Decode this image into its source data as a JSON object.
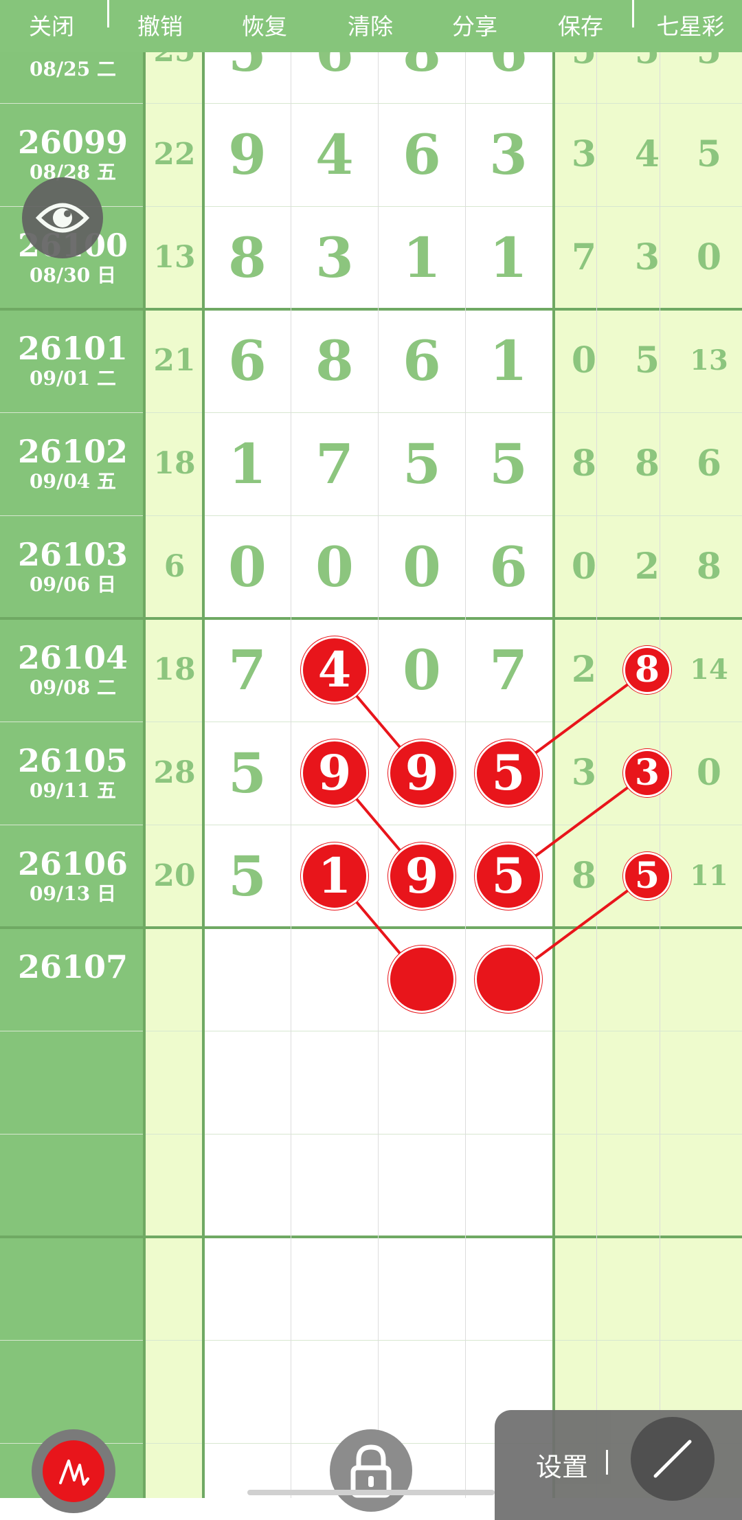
{
  "toolbar": {
    "close": "关闭",
    "undo": "撤销",
    "redo": "恢复",
    "clear": "清除",
    "share": "分享",
    "save": "保存",
    "lottery": "七星彩"
  },
  "rows": [
    {
      "issue": "",
      "date": "08/25 二",
      "sum": "25",
      "main": [
        "5",
        "6",
        "8",
        "6"
      ],
      "tail": [
        "5",
        "5",
        "5"
      ]
    },
    {
      "issue": "26099",
      "date": "08/28 五",
      "sum": "22",
      "main": [
        "9",
        "4",
        "6",
        "3"
      ],
      "tail": [
        "3",
        "4",
        "5"
      ]
    },
    {
      "issue": "26100",
      "date": "08/30 日",
      "sum": "13",
      "main": [
        "8",
        "3",
        "1",
        "1"
      ],
      "tail": [
        "7",
        "3",
        "0"
      ]
    },
    {
      "issue": "26101",
      "date": "09/01 二",
      "sum": "21",
      "main": [
        "6",
        "8",
        "6",
        "1"
      ],
      "tail": [
        "0",
        "5",
        "13"
      ]
    },
    {
      "issue": "26102",
      "date": "09/04 五",
      "sum": "18",
      "main": [
        "1",
        "7",
        "5",
        "5"
      ],
      "tail": [
        "8",
        "8",
        "6"
      ]
    },
    {
      "issue": "26103",
      "date": "09/06 日",
      "sum": "6",
      "main": [
        "0",
        "0",
        "0",
        "6"
      ],
      "tail": [
        "0",
        "2",
        "8"
      ]
    },
    {
      "issue": "26104",
      "date": "09/08 二",
      "sum": "18",
      "main": [
        "7",
        "4",
        "0",
        "7"
      ],
      "tail": [
        "2",
        "8",
        "14"
      ]
    },
    {
      "issue": "26105",
      "date": "09/11 五",
      "sum": "28",
      "main": [
        "5",
        "9",
        "9",
        "5"
      ],
      "tail": [
        "3",
        "3",
        "0"
      ]
    },
    {
      "issue": "26106",
      "date": "09/13 日",
      "sum": "20",
      "main": [
        "5",
        "1",
        "9",
        "5"
      ],
      "tail": [
        "8",
        "5",
        "11"
      ]
    },
    {
      "issue": "26107",
      "date": "",
      "sum": "",
      "main": [
        "",
        "",
        "",
        ""
      ],
      "tail": [
        "",
        "",
        ""
      ]
    }
  ],
  "highlights": [
    {
      "row": 6,
      "col": "main1",
      "value": "4"
    },
    {
      "row": 7,
      "col": "main1",
      "value": "9"
    },
    {
      "row": 7,
      "col": "main2",
      "value": "9"
    },
    {
      "row": 7,
      "col": "main3",
      "value": "5"
    },
    {
      "row": 8,
      "col": "main1",
      "value": "1"
    },
    {
      "row": 8,
      "col": "main2",
      "value": "9"
    },
    {
      "row": 8,
      "col": "main3",
      "value": "5"
    },
    {
      "row": 9,
      "col": "main2",
      "value": ""
    },
    {
      "row": 9,
      "col": "main3",
      "value": ""
    },
    {
      "row": 6,
      "col": "tail1",
      "value": "8"
    },
    {
      "row": 7,
      "col": "tail1",
      "value": "3"
    },
    {
      "row": 8,
      "col": "tail1",
      "value": "5"
    }
  ],
  "controls": {
    "settings": "设置",
    "eye_icon": "eye-icon",
    "pen_icon": "pen-icon",
    "lock_icon": "lock-icon",
    "line_icon": "line-icon"
  },
  "colors": {
    "accent_green": "#86c57b",
    "number_green": "#8cc57e",
    "highlight_red": "#e8151b",
    "pale_yellow": "#eefbcd"
  }
}
